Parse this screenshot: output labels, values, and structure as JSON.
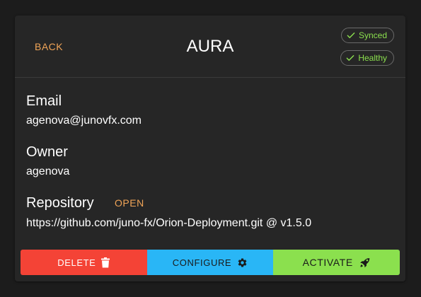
{
  "header": {
    "back_label": "BACK",
    "title": "AURA",
    "badges": [
      {
        "label": "Synced",
        "icon": "check-icon"
      },
      {
        "label": "Healthy",
        "icon": "check-icon"
      }
    ]
  },
  "fields": {
    "email": {
      "label": "Email",
      "value": "agenova@junovfx.com"
    },
    "owner": {
      "label": "Owner",
      "value": "agenova"
    },
    "repository": {
      "label": "Repository",
      "open_label": "OPEN",
      "value": "https://github.com/juno-fx/Orion-Deployment.git @ v1.5.0"
    }
  },
  "actions": {
    "delete": {
      "label": "DELETE",
      "icon": "trash-icon",
      "color": "#f44336"
    },
    "configure": {
      "label": "CONFIGURE",
      "icon": "gear-icon",
      "color": "#29b6f6"
    },
    "activate": {
      "label": "ACTIVATE",
      "icon": "rocket-icon",
      "color": "#8be04e"
    }
  },
  "colors": {
    "background": "#1c1c1c",
    "card": "#262626",
    "accent_orange": "#f0a457",
    "status_green": "#8be04e"
  }
}
